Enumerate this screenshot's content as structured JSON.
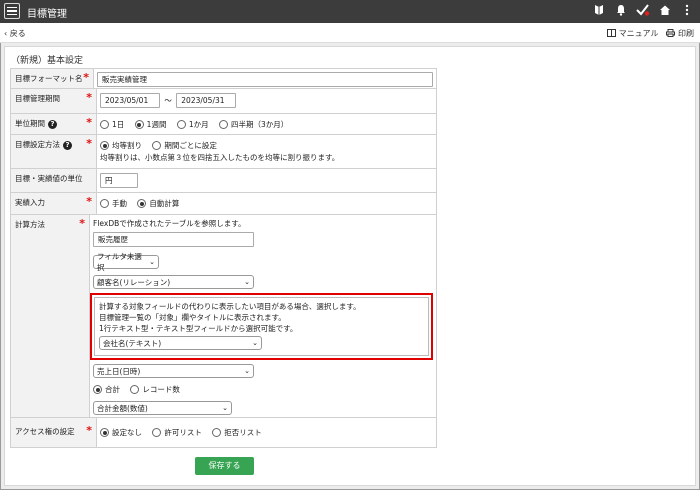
{
  "header": {
    "title": "目標管理",
    "icons": [
      "beginner-icon",
      "bell-icon",
      "check-icon",
      "home-icon",
      "more-icon"
    ]
  },
  "subbar": {
    "back_label": "戻る",
    "manual_label": "マニュアル",
    "print_label": "印刷"
  },
  "section_title": "（新規）基本設定",
  "form": {
    "format_name": {
      "label": "目標フォーマット名",
      "value": "販売実績管理"
    },
    "period": {
      "label": "目標管理期間",
      "start": "2023/05/01",
      "sep": "〜",
      "end": "2023/05/31"
    },
    "unit_period": {
      "label": "単位期間",
      "options": [
        "1日",
        "1週間",
        "1か月",
        "四半期（3か月）"
      ],
      "selected": 1
    },
    "setting_method": {
      "label": "目標設定方法",
      "options": [
        "均等割り",
        "期間ごとに設定"
      ],
      "selected": 0,
      "note": "均等割りは、小数点第３位を四捨五入したものを均等に割り振ります。"
    },
    "unit": {
      "label": "目標・実績値の単位",
      "value": "円"
    },
    "actual_input": {
      "label": "実績入力",
      "options": [
        "手動",
        "自動計算"
      ],
      "selected": 1
    },
    "calc_method": {
      "label": "計算方法",
      "intro": "FlexDBで作成されたテーブルを参照します。",
      "table_value": "販売履歴",
      "filter_select": "フィルタ未選択",
      "target_select": "顧客名(リレーション)",
      "highlight": {
        "line1": "計算する対象フィールドの代わりに表示したい項目がある場合、選択します。",
        "line2": "目標管理一覧の「対象」欄やタイトルに表示されます。",
        "line3": "1行テキスト型・テキスト型フィールドから選択可能です。",
        "select": "会社名(テキスト)"
      },
      "date_select": "売上日(日時)",
      "agg_options": [
        "合計",
        "レコード数"
      ],
      "agg_selected": 0,
      "amount_select": "合計金額(数値)"
    },
    "access": {
      "label": "アクセス権の設定",
      "options": [
        "設定なし",
        "許可リスト",
        "拒否リスト"
      ],
      "selected": 0
    }
  },
  "save_label": "保存する"
}
